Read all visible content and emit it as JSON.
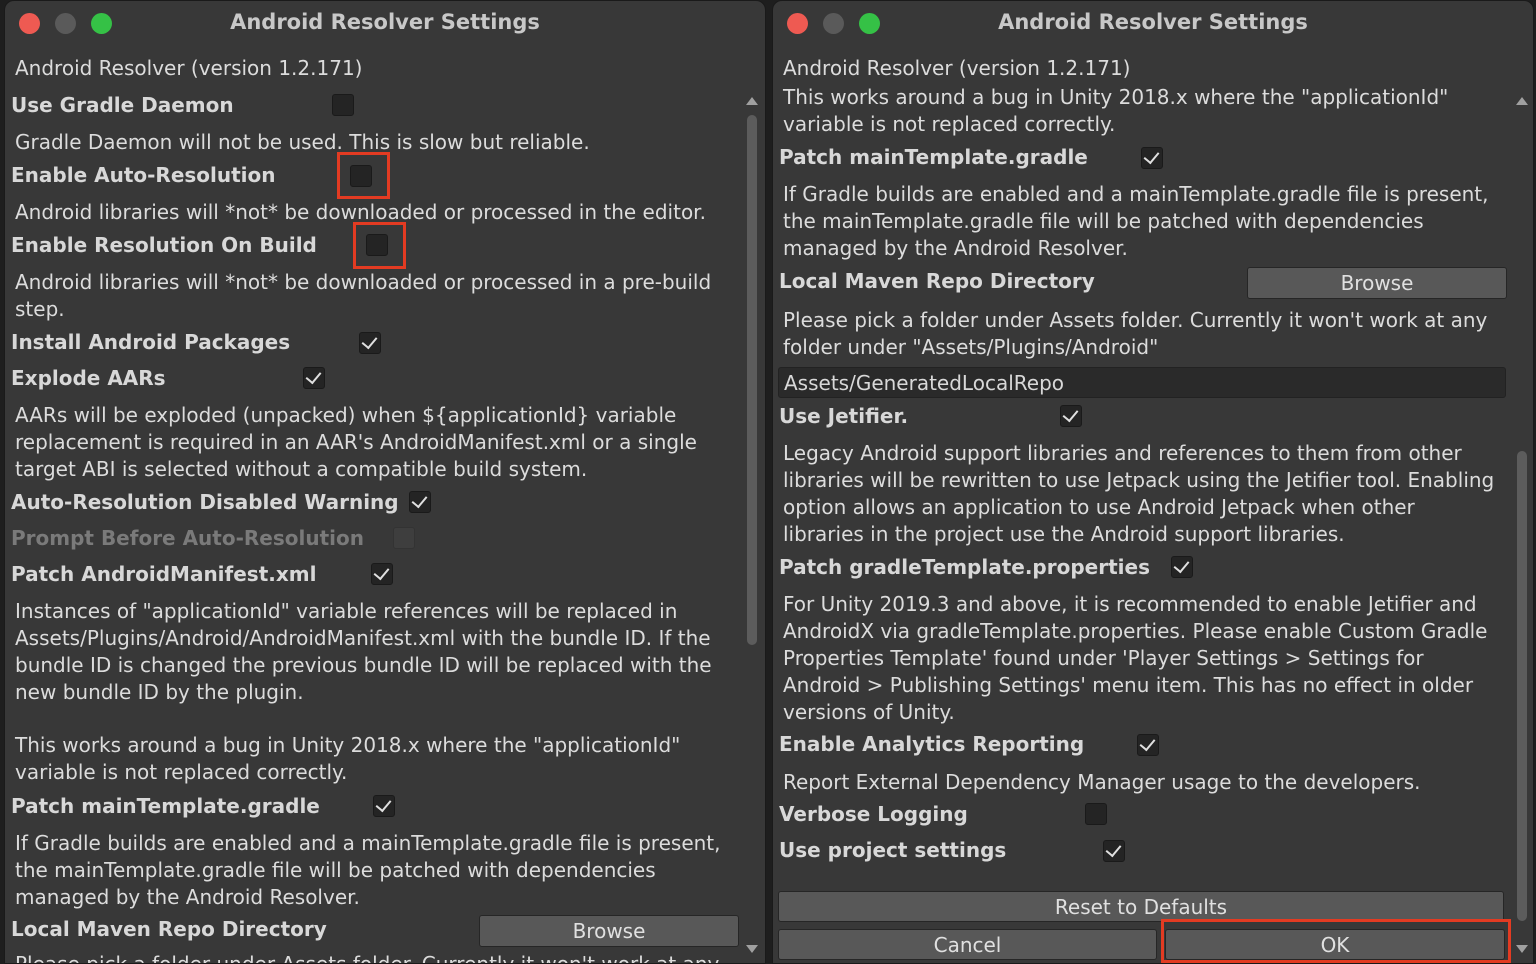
{
  "window_title": "Android Resolver Settings",
  "left": {
    "version": "Android Resolver (version 1.2.171)",
    "use_gradle_daemon": "Use Gradle Daemon",
    "gradle_daemon_desc": "Gradle Daemon will not be used.  This is slow but reliable.",
    "enable_auto_resolution": "Enable Auto-Resolution",
    "auto_resolution_desc": "Android libraries will *not* be downloaded or processed in the editor.",
    "enable_resolution_on_build": "Enable Resolution On Build",
    "resolution_on_build_desc_1": "Android libraries will *not* be downloaded or processed in a pre-build",
    "resolution_on_build_desc_2": "step.",
    "install_android_packages": "Install Android Packages",
    "explode_aars": "Explode AARs",
    "explode_desc_1": "AARs will be exploded (unpacked) when ${applicationId} variable",
    "explode_desc_2": "replacement is required in an AAR's AndroidManifest.xml or a single",
    "explode_desc_3": "target ABI is selected without a compatible build system.",
    "auto_resolution_disabled_warning": "Auto-Resolution Disabled Warning",
    "prompt_before_auto_resolution": "Prompt Before Auto-Resolution",
    "patch_android_manifest": "Patch AndroidManifest.xml",
    "manifest_desc_1": "Instances of \"applicationId\" variable references will be replaced in",
    "manifest_desc_2": "Assets/Plugins/Android/AndroidManifest.xml with the bundle ID.  If the",
    "manifest_desc_3": "bundle ID is changed the previous bundle ID will be replaced with the",
    "manifest_desc_4": "new bundle ID by the plugin.",
    "bug_desc_1": "This works around a bug in Unity 2018.x where the \"applicationId\"",
    "bug_desc_2": "variable is not replaced correctly.",
    "patch_main_template": "Patch mainTemplate.gradle",
    "main_template_desc_1": "If Gradle builds are enabled and a mainTemplate.gradle file is present,",
    "main_template_desc_2": "the mainTemplate.gradle file will be patched with dependencies",
    "main_template_desc_3": "managed by the Android Resolver.",
    "local_maven_repo": "Local Maven Repo Directory",
    "browse": "Browse",
    "cut_off_text": "Please pick a folder under Assets folder.  Currently it won't work at any"
  },
  "right": {
    "version": "Android Resolver (version 1.2.171)",
    "bug_desc_1": "This works around a bug in Unity 2018.x where the \"applicationId\"",
    "bug_desc_2": "variable is not replaced correctly.",
    "patch_main_template": "Patch mainTemplate.gradle",
    "main_template_desc_1": "If Gradle builds are enabled and a mainTemplate.gradle file is present,",
    "main_template_desc_2": "the mainTemplate.gradle file will be patched with dependencies",
    "main_template_desc_3": "managed by the Android Resolver.",
    "local_maven_repo": "Local Maven Repo Directory",
    "browse": "Browse",
    "folder_desc_1": "Please pick a folder under Assets folder.  Currently it won't work at any",
    "folder_desc_2": "folder under \"Assets/Plugins/Android\"",
    "repo_path": "Assets/GeneratedLocalRepo",
    "use_jetifier": "Use Jetifier.",
    "jetifier_desc_1": "Legacy Android support libraries and references to them from other",
    "jetifier_desc_2": "libraries will be rewritten to use Jetpack using the Jetifier tool. Enabling",
    "jetifier_desc_3": "option allows an application to use Android Jetpack when other",
    "jetifier_desc_4": "libraries in the project use the Android support libraries.",
    "patch_gradle_template_props": "Patch gradleTemplate.properties",
    "props_desc_1": "For Unity 2019.3 and above, it is recommended to enable Jetifier and",
    "props_desc_2": "AndroidX via gradleTemplate.properties. Please enable Custom Gradle",
    "props_desc_3": "Properties Template' found under 'Player Settings > Settings for",
    "props_desc_4": "Android > Publishing Settings' menu item. This has no effect in older",
    "props_desc_5": "versions of Unity.",
    "enable_analytics": "Enable Analytics Reporting",
    "analytics_desc": "Report External Dependency Manager usage to the developers.",
    "verbose_logging": "Verbose Logging",
    "use_project_settings": "Use project settings",
    "reset_defaults": "Reset to Defaults",
    "cancel": "Cancel",
    "ok": "OK"
  },
  "colors": {
    "highlight": "#e33b22",
    "window_bg": "#383838",
    "close": "#ee5a52",
    "zoom": "#35c146"
  }
}
